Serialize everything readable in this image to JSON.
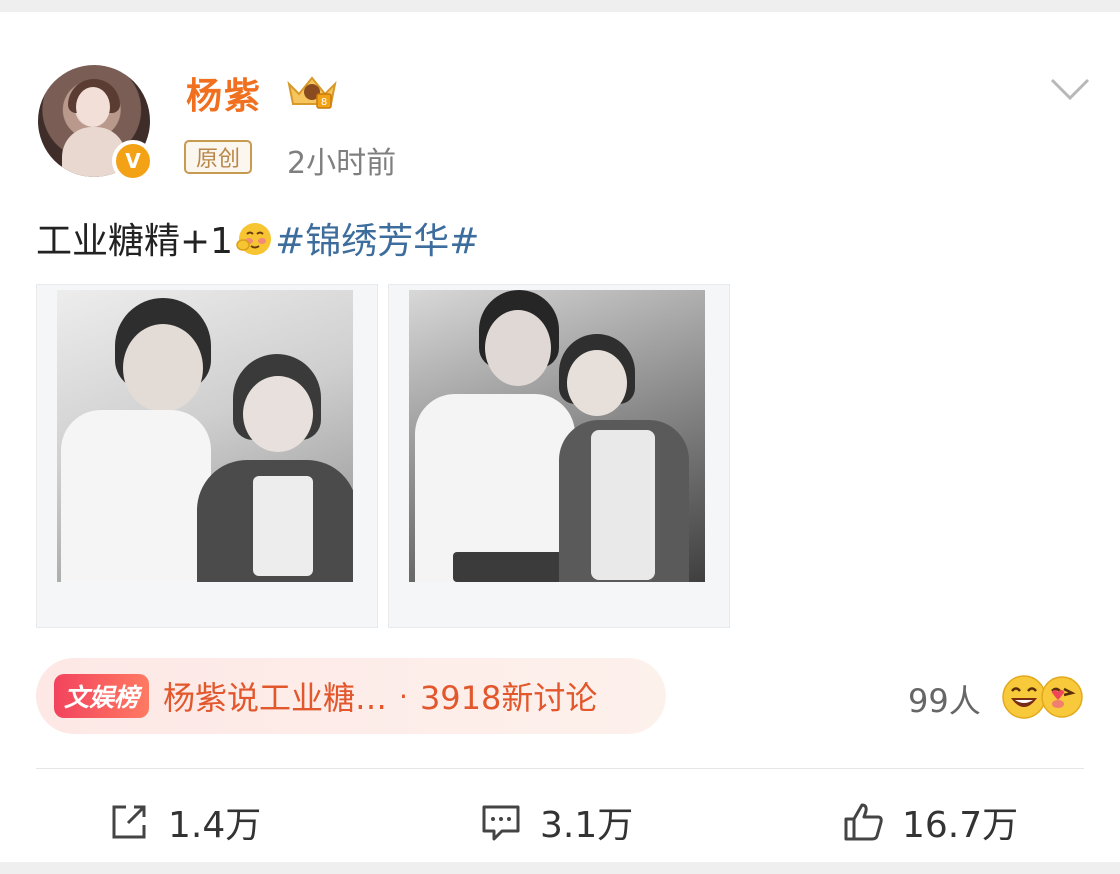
{
  "author": {
    "name": "杨紫",
    "verified_badge": "V",
    "badge_icon": "crown-medal-icon",
    "avatar_icon": "avatar"
  },
  "meta": {
    "tag": "原创",
    "time": "2小时前"
  },
  "post": {
    "text": "工业糖精+1",
    "emoji": "blush-face-emoji",
    "hashtag": "#锦绣芳华#"
  },
  "photos": [
    {
      "name": "photo-1",
      "description": ""
    },
    {
      "name": "photo-2",
      "description": ""
    }
  ],
  "trend": {
    "badge": "文娱榜",
    "text": "杨紫说工业糖…",
    "separator": "·",
    "count": "3918新讨论"
  },
  "reactions": {
    "count": "99人",
    "icons": [
      "laughing-face-icon",
      "kissing-face-icon"
    ]
  },
  "actions": {
    "share": "1.4万",
    "comment": "3.1万",
    "like": "16.7万"
  },
  "colors": {
    "username": "#f0701f",
    "hashtag": "#3d6d9c",
    "trend_text": "#e2572c",
    "badge_v": "#f3a216"
  }
}
